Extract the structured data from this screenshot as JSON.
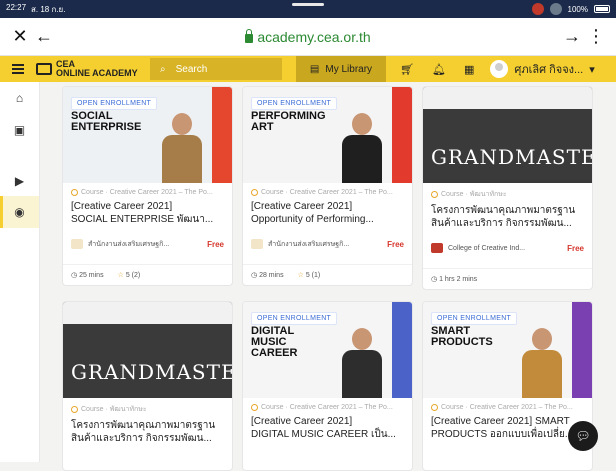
{
  "statusbar": {
    "time": "22:27",
    "date": "ส. 18 ก.ย.",
    "battery": "100%"
  },
  "browser": {
    "url": "academy.cea.or.th"
  },
  "header": {
    "logo_line1": "CEA",
    "logo_line2": "ONLINE ACADEMY",
    "search_placeholder": "Search",
    "library_label": "My Library",
    "user_name": "ศุภเลิศ กิจจง..."
  },
  "courses": [
    {
      "badge": "OPEN ENROLLMENT",
      "thumb_title": "SOCIAL ENTERPRISE",
      "meta": "Course · Creative Career 2021 – The Po...",
      "course_word": "Course",
      "title_line1": "[Creative Career 2021]",
      "title_line2": "SOCIAL ENTERPRISE พัฒนา...",
      "provider": "สำนักงานส่งเสริมเศรษฐกิ...",
      "price": "Free",
      "duration": "25 mins",
      "rating": "5 (2)"
    },
    {
      "badge": "OPEN ENROLLMENT",
      "thumb_title": "PERFORMING ART",
      "meta": "Course · Creative Career 2021 – The Po...",
      "course_word": "Course",
      "title_line1": "[Creative Career 2021]",
      "title_line2": "Opportunity of Performing...",
      "provider": "สำนักงานส่งเสริมเศรษฐกิ...",
      "price": "Free",
      "duration": "28 mins",
      "rating": "5 (1)"
    },
    {
      "badge": "",
      "thumb_title": "GRANDMASTER",
      "meta": "Course · พัฒนาทักษะ",
      "course_word": "Course",
      "title_line1": "โครงการพัฒนาคุณภาพมาตรฐาน",
      "title_line2": "สินค้าและบริการ กิจกรรมพัฒน...",
      "provider": "College of Creative Ind...",
      "price": "Free",
      "duration": "1 hrs 2 mins",
      "rating": ""
    },
    {
      "badge": "",
      "thumb_title": "GRANDMASTER",
      "meta": "Course · พัฒนาทักษะ",
      "course_word": "Course",
      "title_line1": "โครงการพัฒนาคุณภาพมาตรฐาน",
      "title_line2": "สินค้าและบริการ กิจกรรมพัฒน...",
      "provider": "",
      "price": "",
      "duration": "",
      "rating": ""
    },
    {
      "badge": "OPEN ENROLLMENT",
      "thumb_title": "DIGITAL MUSIC CAREER",
      "meta": "Course · Creative Career 2021 – The Po...",
      "course_word": "Course",
      "title_line1": "[Creative Career 2021]",
      "title_line2": "DIGITAL MUSIC CAREER เป็น...",
      "provider": "",
      "price": "",
      "duration": "",
      "rating": ""
    },
    {
      "badge": "OPEN ENROLLMENT",
      "thumb_title": "SMART PRODUCTS",
      "meta": "Course · Creative Career 2021 – The Po...",
      "course_word": "Course",
      "title_line1": "[Creative Career 2021] SMART",
      "title_line2": "PRODUCTS ออกแบบเพื่อเปลี่ย...",
      "provider": "",
      "price": "",
      "duration": "",
      "rating": ""
    }
  ]
}
